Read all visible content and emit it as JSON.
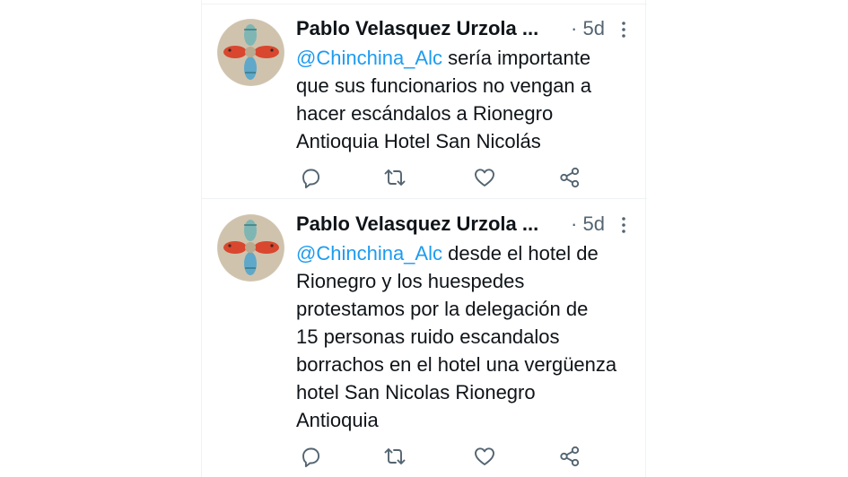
{
  "tweets": [
    {
      "author": "Pablo Velasquez Urzola ...",
      "separator": "·",
      "time": "5d",
      "mention": "@Chinchina_Alc",
      "text": " sería importante\nque sus funcionarios no vengan a\nhacer escándalos a Rionegro\nAntioquia Hotel San Nicolás"
    },
    {
      "author": "Pablo Velasquez Urzola ...",
      "separator": "·",
      "time": "5d",
      "mention": "@Chinchina_Alc",
      "text": " desde el hotel de\nRionegro y los huespedes\nprotestamos por la delegación de\n15 personas ruido escandalos\nborrachos en el hotel una vergüenza\nhotel San Nicolas Rionegro\nAntioquia"
    }
  ],
  "icons": {
    "reply": "reply-icon",
    "retweet": "retweet-icon",
    "like": "heart-icon",
    "share": "share-icon",
    "more": "more-icon"
  },
  "colors": {
    "text": "#0f1419",
    "secondary": "#536471",
    "link": "#1d9bf0",
    "divider": "#eff3f4"
  }
}
